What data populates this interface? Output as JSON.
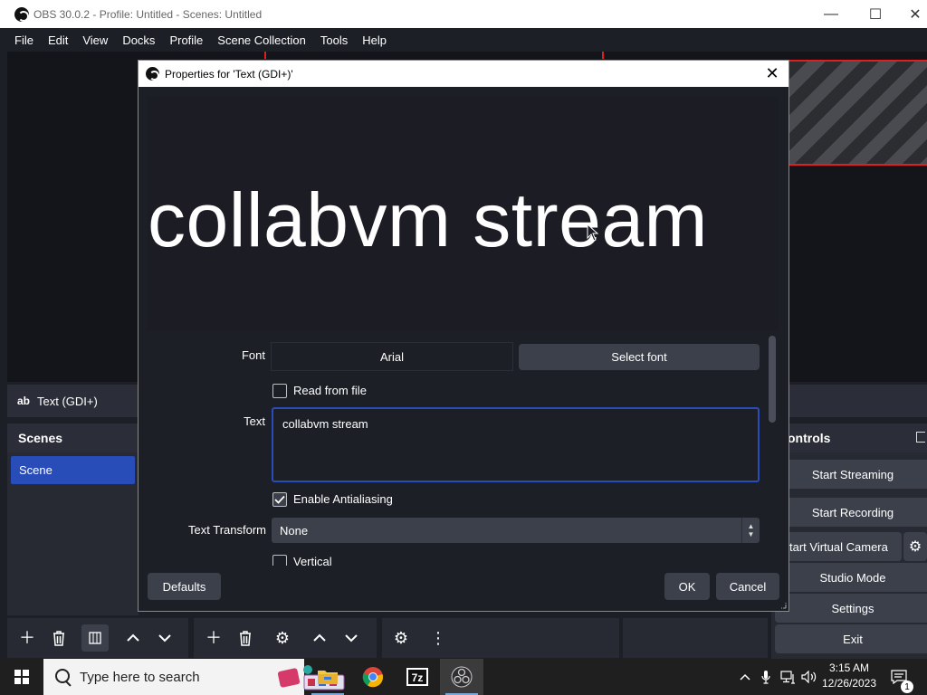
{
  "window": {
    "title": "OBS 30.0.2 - Profile: Untitled - Scenes: Untitled",
    "minimize": "—",
    "maximize": "☐",
    "close": "✕"
  },
  "menubar": [
    "File",
    "Edit",
    "View",
    "Docks",
    "Profile",
    "Scene Collection",
    "Tools",
    "Help"
  ],
  "sources": {
    "selected_icon": "ab",
    "selected_label": "Text (GDI+)"
  },
  "scenes_panel": {
    "header": "Scenes",
    "items": [
      "Scene"
    ]
  },
  "controls_panel": {
    "header": "ontrols",
    "buttons": {
      "start_streaming": "Start Streaming",
      "start_recording": "Start Recording",
      "virtual_camera": "tart Virtual Camera",
      "studio_mode": "Studio Mode",
      "settings": "Settings",
      "exit": "Exit"
    }
  },
  "dialog": {
    "title": "Properties for 'Text (GDI+)'",
    "close": "✕",
    "preview_text": "collabvm stream",
    "font_label": "Font",
    "font_value": "Arial",
    "select_font": "Select font",
    "read_from_file": "Read from file",
    "read_from_file_checked": false,
    "text_label": "Text",
    "text_value": "collabvm stream",
    "enable_antialiasing": "Enable Antialiasing",
    "enable_antialiasing_checked": true,
    "text_transform_label": "Text Transform",
    "text_transform_value": "None",
    "vertical": "Vertical",
    "defaults_button": "Defaults",
    "ok_button": "OK",
    "cancel_button": "Cancel"
  },
  "taskbar": {
    "search_placeholder": "Type here to search",
    "time": "3:15 AM",
    "date": "12/26/2023"
  },
  "colors": {
    "accent_blue": "#284cb8",
    "panel_bg": "#272a33",
    "button_bg": "#3c404b",
    "canvas_red": "#e02020"
  }
}
